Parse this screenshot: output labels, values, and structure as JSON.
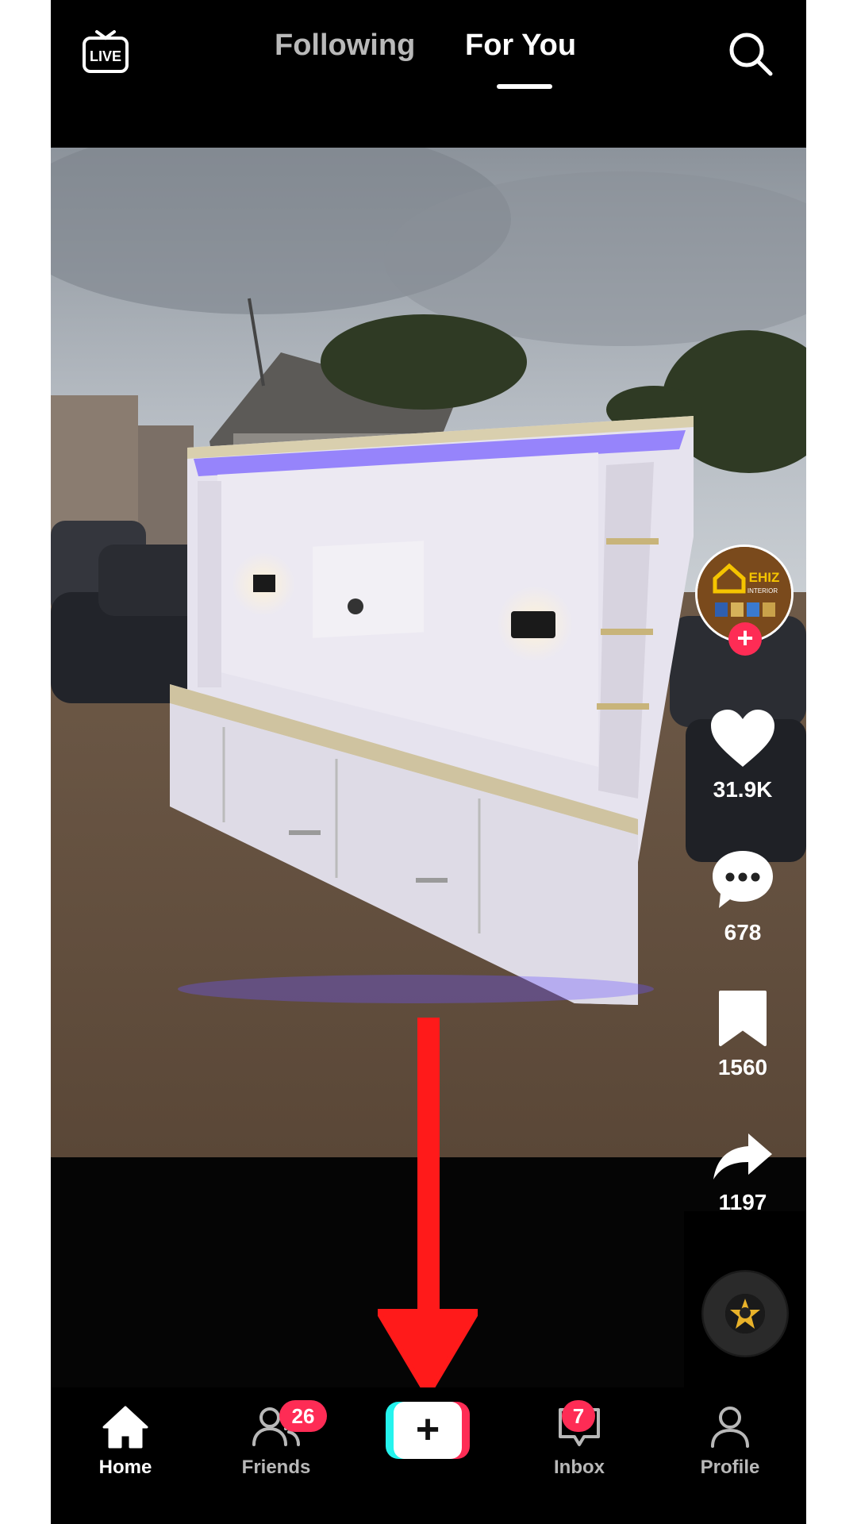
{
  "top_bar": {
    "live_label": "LIVE",
    "tabs": [
      {
        "label": "Following",
        "active": false
      },
      {
        "label": "For You",
        "active": true
      }
    ]
  },
  "creator": {
    "avatar_text": "EHIZ",
    "avatar_subtext": "INTERIOR",
    "follow_symbol": "+"
  },
  "actions": {
    "likes": "31.9K",
    "comments": "678",
    "bookmarks": "1560",
    "shares": "1197"
  },
  "bottom_nav": {
    "items": [
      {
        "label": "Home",
        "icon": "home-icon",
        "active": true
      },
      {
        "label": "Friends",
        "icon": "friends-icon",
        "badge": "26"
      },
      {
        "label": "",
        "icon": "create-icon",
        "symbol": "+"
      },
      {
        "label": "Inbox",
        "icon": "inbox-icon",
        "badge": "7"
      },
      {
        "label": "Profile",
        "icon": "profile-icon"
      }
    ]
  },
  "colors": {
    "brand_red": "#fe2c55",
    "brand_cyan": "#25f4ee",
    "annotation_arrow": "#ff1a1a",
    "background": "#000000"
  }
}
